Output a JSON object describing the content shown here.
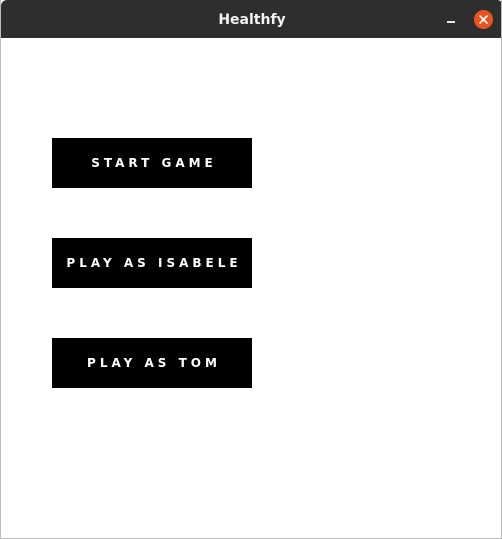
{
  "window": {
    "title": "Healthfy",
    "controls": {
      "minimize_icon": "minimize-icon",
      "close_icon": "close-icon",
      "close_color": "#e95420"
    },
    "titlebar_color": "#2f2e2e"
  },
  "menu": {
    "buttons": [
      {
        "label": "START GAME"
      },
      {
        "label": "PLAY AS ISABELE"
      },
      {
        "label": "PLAY AS TOM"
      }
    ],
    "button_color": "#000000",
    "text_color": "#ffffff"
  }
}
